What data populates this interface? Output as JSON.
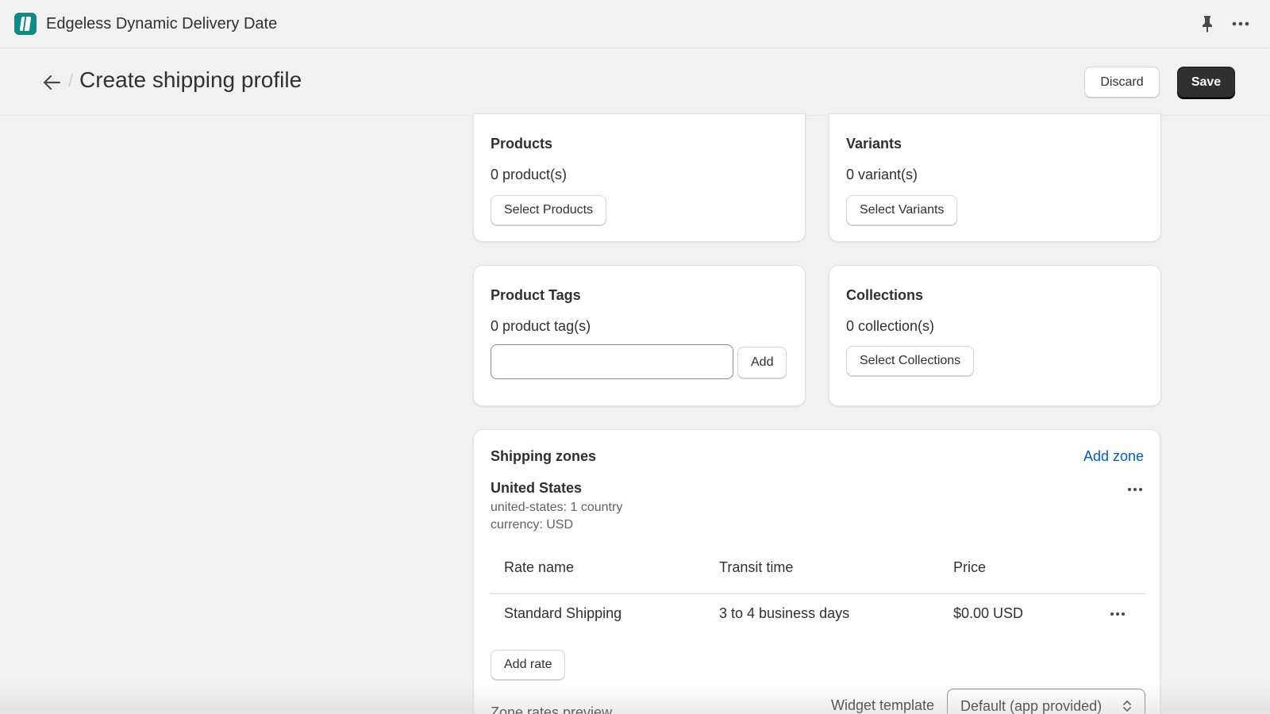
{
  "app": {
    "title": "Edgeless Dynamic Delivery Date",
    "logo_icon": "app-logo-icon",
    "pin_icon": "pin-icon",
    "more_icon": "more-horizontal-icon"
  },
  "header": {
    "title": "Create shipping profile",
    "discard_label": "Discard",
    "save_label": "Save",
    "back_icon": "arrow-left-icon"
  },
  "products": {
    "title": "Products",
    "count": "0 product(s)",
    "button": "Select Products"
  },
  "variants": {
    "title": "Variants",
    "count": "0 variant(s)",
    "button": "Select Variants"
  },
  "tags": {
    "title": "Product Tags",
    "count": "0 product tag(s)",
    "input_value": "",
    "input_placeholder": "",
    "button": "Add"
  },
  "collections": {
    "title": "Collections",
    "count": "0 collection(s)",
    "button": "Select Collections"
  },
  "zones": {
    "title": "Shipping zones",
    "add_zone": "Add zone",
    "zone": {
      "name": "United States",
      "countries": "united-states: 1 country",
      "currency": "currency: USD"
    },
    "columns": [
      "Rate name",
      "Transit time",
      "Price"
    ],
    "rows": [
      {
        "rate_name": "Standard Shipping",
        "transit_time": "3 to 4 business days",
        "price": "$0.00 USD"
      }
    ],
    "add_rate": "Add rate",
    "preview_label": "Zone rates preview",
    "widget_label": "Widget template",
    "widget_value": "Default (app provided)"
  },
  "colors": {
    "accent_link": "#005bd3",
    "primary_button": "#303030",
    "app_logo": "#0f8a84"
  }
}
